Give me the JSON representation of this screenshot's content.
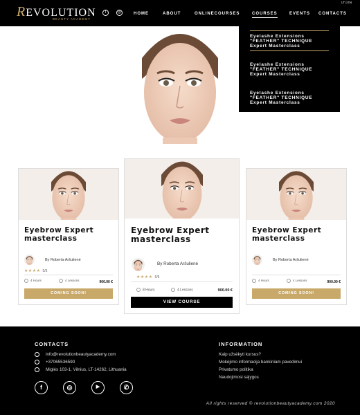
{
  "brand": {
    "name_initial": "R",
    "name_rest": "EVOLUTION",
    "tagline": "BEAUTY ACADEMY"
  },
  "header": {
    "social": [
      {
        "icon": "facebook-icon",
        "glyph": "f"
      },
      {
        "icon": "instagram-icon",
        "glyph": "◎"
      }
    ],
    "nav": [
      "HOME",
      "ABOUT",
      "ONLINECOURSES",
      "COURSES",
      "EVENTS",
      "CONTACTS"
    ],
    "lang": "LT | EN"
  },
  "dropdown": {
    "items": [
      "Eyelashe Extensions \"FEATHER\" TECHNIQUE Expert Masterclass",
      "Eyelashe Extensions \"FEATHER\" TECHNIQUE Expert Masterclass",
      "Eyelashe Extensions \"FEATHER\" TECHNIQUE Expert Masterclass"
    ]
  },
  "cards": [
    {
      "title": "Eyebrow Expert masterclass",
      "author": "By Roberta Aršulienė",
      "stars": "★★★★",
      "rating": "5/5",
      "hours": "4 Hours",
      "lessons": "4 Lessons",
      "price": "900.00 €",
      "button": "COMING SOON!"
    },
    {
      "title": "Eyebrow Expert masterclass",
      "author": "By Roberta Aršulienė",
      "stars": "★★★★",
      "rating": "5/5",
      "hours": "8 Hours",
      "lessons": "4 Lessons",
      "price": "900.00 €",
      "button": "VIEW COURSE"
    },
    {
      "title": "Eyebrow Expert masterclass",
      "author": "By Roberta Aršulienė",
      "stars": "",
      "rating": "",
      "hours": "4 Hours",
      "lessons": "4 Lessons",
      "price": "900.00 €",
      "button": "COMING SOON!"
    }
  ],
  "footer": {
    "contacts_heading": "CONTACTS",
    "email": "info@revolutionbeautyacademy.com",
    "phone": "+37065536590",
    "address": "Miglės 103-1, Vilnius, LT-14262, Lithuania",
    "social": [
      {
        "icon": "facebook-icon",
        "glyph": "f"
      },
      {
        "icon": "instagram-icon",
        "glyph": "◎"
      },
      {
        "icon": "youtube-icon",
        "glyph": "▶"
      },
      {
        "icon": "whatsapp-icon",
        "glyph": "✆"
      }
    ],
    "info_heading": "INFORMATION",
    "links": [
      "Kaip užsėkyti kursus?",
      "Mokėjimo informacija bankiniam pavedimui",
      "Privatumo politika",
      "Naudojimosi sąlygos"
    ],
    "copyright": "All rights reserved © revolutionbeautyacademy.com 2020"
  },
  "colors": {
    "gold": "#c9a96a",
    "black": "#000000"
  }
}
